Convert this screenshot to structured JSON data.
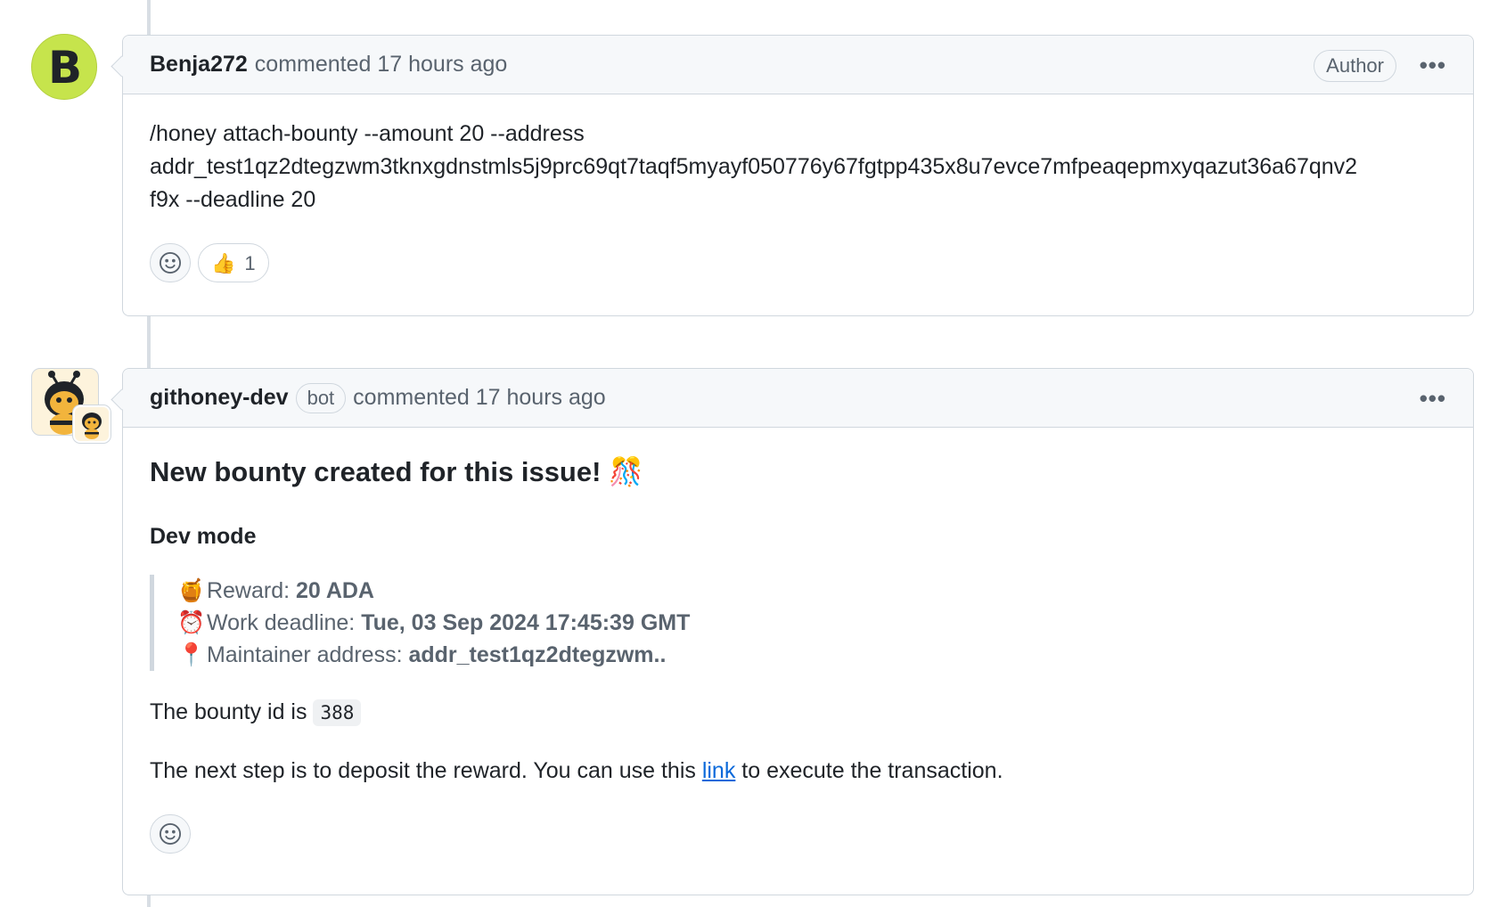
{
  "comments": [
    {
      "author": "Benja272",
      "action": "commented 17 hours ago",
      "role_label": "Author",
      "avatar_letter": "B",
      "avatar_color": "#c6e44c",
      "body_lines": [
        "/honey attach-bounty --amount 20 --address",
        "addr_test1qz2dtegzwm3tknxgdnstmls5j9prc69qt7taqf5myayf050776y67fgtpp435x8u7evce7mfpeaqepmxyqazut36a67qnv2",
        "f9x --deadline 20"
      ],
      "reactions": [
        {
          "emoji": "👍",
          "count": "1"
        }
      ]
    },
    {
      "author": "githoney-dev",
      "bot_label": "bot",
      "action": "commented 17 hours ago",
      "title": "New bounty created for this issue! 🎊",
      "subheading": "Dev mode",
      "details": [
        {
          "icon": "🍯",
          "label": "Reward: ",
          "value": "20 ADA"
        },
        {
          "icon": "⏰",
          "label": "Work deadline: ",
          "value": "Tue, 03 Sep 2024 17:45:39 GMT"
        },
        {
          "icon": "📍",
          "label": "Maintainer address: ",
          "value": "addr_test1qz2dtegzwm.."
        }
      ],
      "bounty_id_text": "The bounty id is ",
      "bounty_id": "388",
      "next_step_before": "The next step is to deposit the reward. You can use this ",
      "next_step_link": "link",
      "next_step_after": " to execute the transaction."
    }
  ],
  "colors": {
    "link": "#0969da",
    "muted": "#59636e",
    "border": "#d0d7de"
  }
}
